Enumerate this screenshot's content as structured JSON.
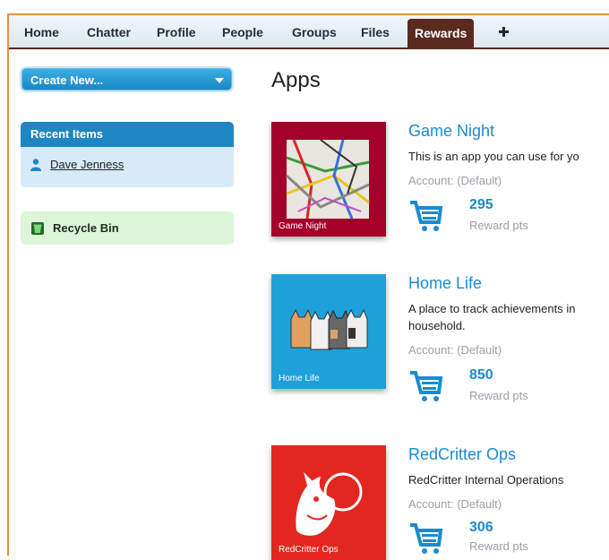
{
  "tabs": [
    {
      "label": "Home",
      "active": false
    },
    {
      "label": "Chatter",
      "active": false
    },
    {
      "label": "Profile",
      "active": false
    },
    {
      "label": "People",
      "active": false
    },
    {
      "label": "Groups",
      "active": false
    },
    {
      "label": "Files",
      "active": false
    },
    {
      "label": "Rewards",
      "active": true
    }
  ],
  "tab_add_icon": "plus-icon",
  "sidebar": {
    "create_new_label": "Create New...",
    "recent_items_title": "Recent Items",
    "recent_items": [
      {
        "label": "Dave Jenness",
        "icon": "person-icon"
      }
    ],
    "recycle_bin_label": "Recycle Bin"
  },
  "main": {
    "title": "Apps",
    "apps": [
      {
        "name": "Game Night",
        "tile_label": "Game Night",
        "tile_color": "#a3002a",
        "description_lines": [
          "This is an app you can use for yo"
        ],
        "account": "Account: (Default)",
        "points": "295",
        "points_label": "Reward pts"
      },
      {
        "name": "Home Life",
        "tile_label": "Home Life",
        "tile_color": "#1ea1d8",
        "description_lines": [
          "A place to track achievements in",
          "household."
        ],
        "account": "Account: (Default)",
        "points": "850",
        "points_label": "Reward pts"
      },
      {
        "name": "RedCritter Ops",
        "tile_label": "RedCritter Ops",
        "tile_color": "#e3261f",
        "description_lines": [
          "RedCritter Internal Operations"
        ],
        "account": "Account: (Default)",
        "points": "306",
        "points_label": "Reward pts"
      }
    ]
  },
  "colors": {
    "frame": "#e8913a",
    "tab_active": "#5a2a1e",
    "link_blue": "#1b8bd0",
    "recent_header": "#1e87c3",
    "recycle_bg": "#dcf5d8"
  }
}
